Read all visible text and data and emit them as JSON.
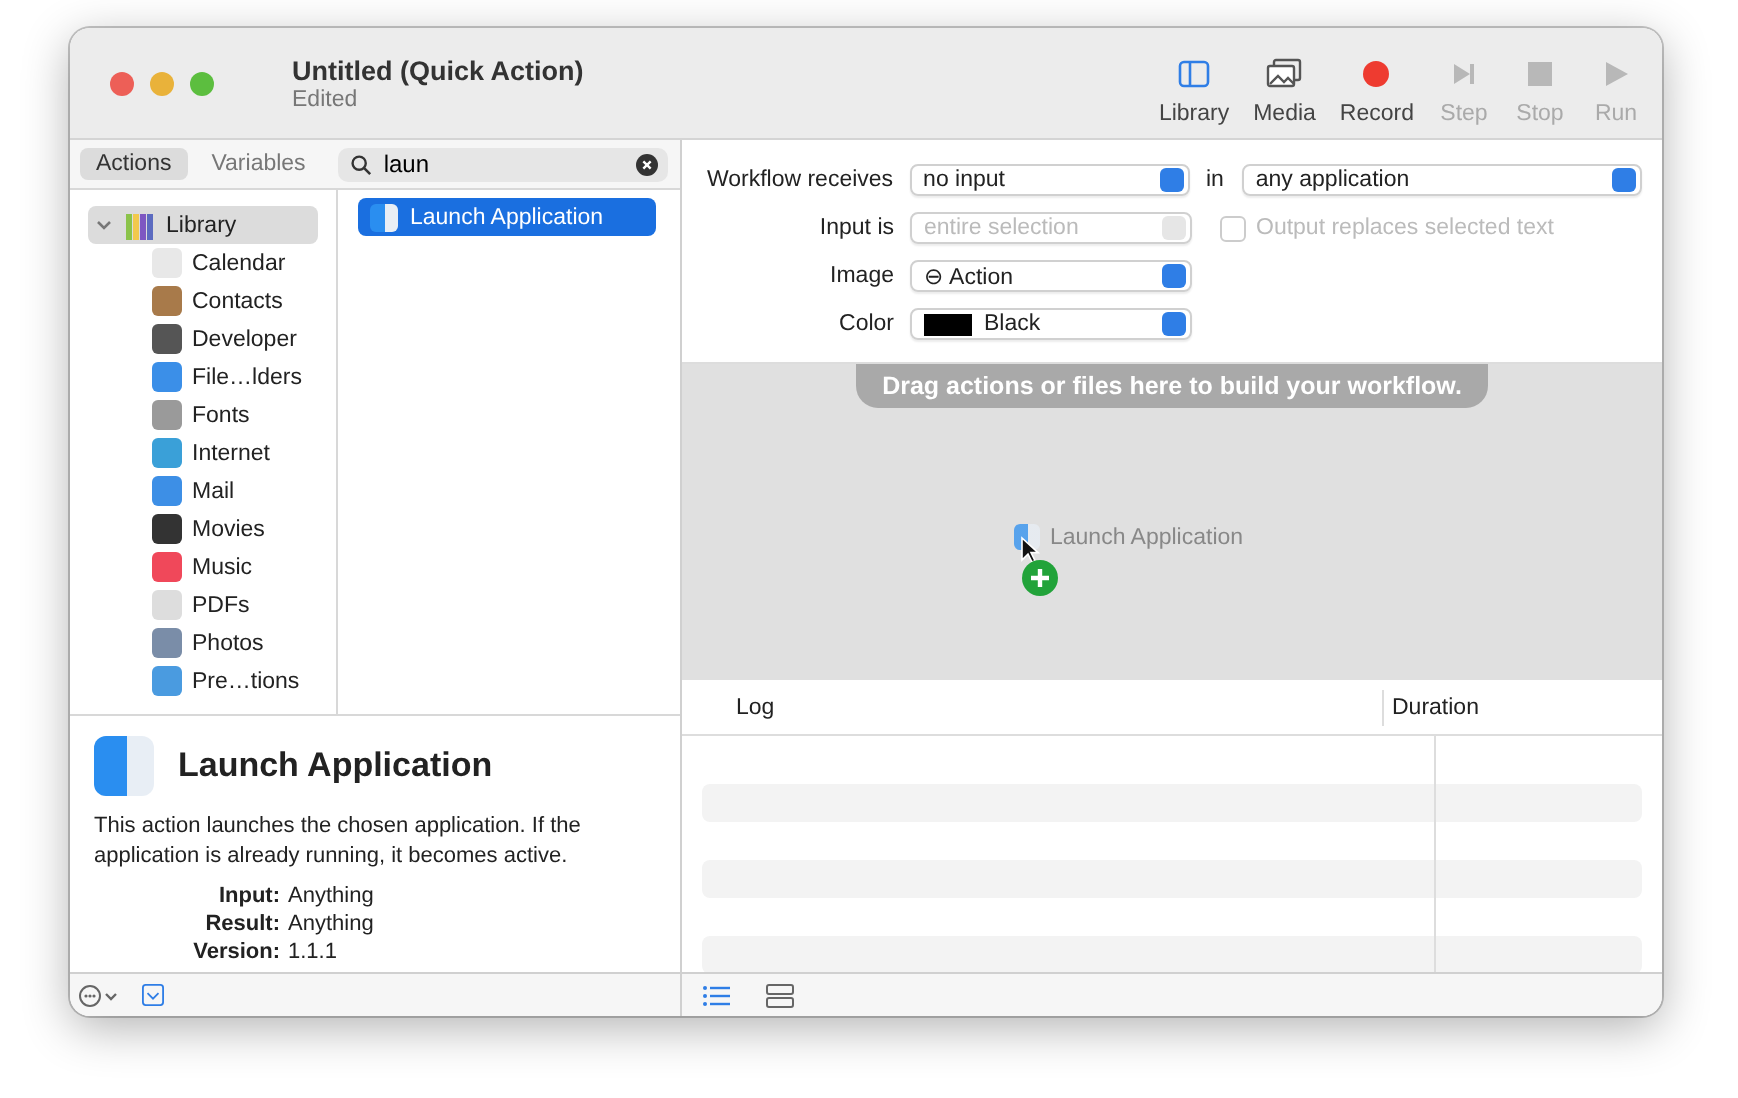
{
  "window": {
    "title": "Untitled (Quick Action)",
    "subtitle": "Edited"
  },
  "toolbar": [
    {
      "label": "Library",
      "kind": "library",
      "disabled": false
    },
    {
      "label": "Media",
      "kind": "media",
      "disabled": false
    },
    {
      "label": "Record",
      "kind": "record",
      "disabled": false
    },
    {
      "label": "Step",
      "kind": "step",
      "disabled": true
    },
    {
      "label": "Stop",
      "kind": "stop",
      "disabled": true
    },
    {
      "label": "Run",
      "kind": "run",
      "disabled": true
    }
  ],
  "library_tabs": [
    {
      "label": "Actions",
      "selected": true
    },
    {
      "label": "Variables",
      "selected": false
    }
  ],
  "search": {
    "value": "laun"
  },
  "sidebar": {
    "items": [
      {
        "label": "Library",
        "expanded": true,
        "selected": true,
        "children": [
          {
            "label": "Calendar",
            "selected": false
          },
          {
            "label": "Contacts",
            "selected": false
          },
          {
            "label": "Developer",
            "selected": false
          },
          {
            "label": "File…lders",
            "selected": false
          },
          {
            "label": "Fonts",
            "selected": false
          },
          {
            "label": "Internet",
            "selected": false
          },
          {
            "label": "Mail",
            "selected": false
          },
          {
            "label": "Movies",
            "selected": false
          },
          {
            "label": "Music",
            "selected": false
          },
          {
            "label": "PDFs",
            "selected": false
          },
          {
            "label": "Photos",
            "selected": false
          },
          {
            "label": "Pre…tions",
            "selected": false
          }
        ]
      }
    ]
  },
  "actions": [
    {
      "label": "Launch Application",
      "selected": true
    }
  ],
  "description": {
    "title": "Launch Application",
    "text": "This action launches the chosen application. If the application is already running, it becomes active.",
    "fields": [
      {
        "label": "Input:",
        "value": "Anything"
      },
      {
        "label": "Result:",
        "value": "Anything"
      },
      {
        "label": "Version:",
        "value": "1.1.1"
      }
    ]
  },
  "settings": {
    "receives": {
      "label": "Workflow receives",
      "value": "no input",
      "in_label": "in",
      "app": "any application"
    },
    "input_is": {
      "label": "Input is",
      "value": "entire selection",
      "disabled": true
    },
    "output_replaces": {
      "label": "Output replaces selected text",
      "checked": false,
      "disabled": true
    },
    "image": {
      "label": "Image",
      "value": "⊖ Action"
    },
    "color": {
      "label": "Color",
      "value": "Black"
    }
  },
  "workflow": {
    "hint": "Drag actions or files here to build your workflow.",
    "dragged_item": "Launch Application"
  },
  "log": {
    "columns": [
      "Log",
      "Duration"
    ]
  }
}
